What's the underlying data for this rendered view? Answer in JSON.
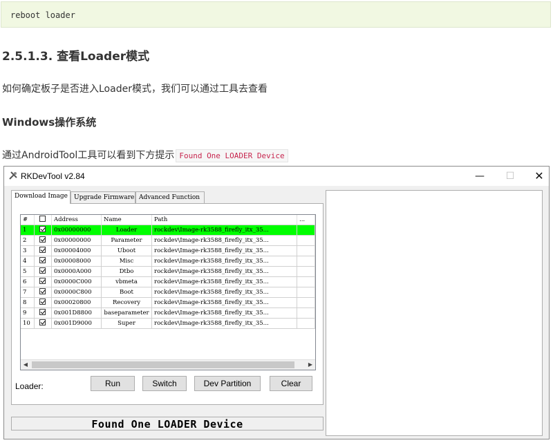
{
  "doc": {
    "code_line": "reboot loader",
    "heading": "2.5.1.3. 查看Loader模式",
    "intro": "如何确定板子是否进入Loader模式，我们可以通过工具去查看",
    "subheading": "Windows操作系统",
    "tool_text": "通过AndroidTool工具可以看到下方提示",
    "inline_code": "Found One LOADER Device"
  },
  "window": {
    "title": "RKDevTool v2.84",
    "minimize": "—",
    "maximize": "☐",
    "close": "✕"
  },
  "tabs": [
    "Download Image",
    "Upgrade Firmware",
    "Advanced Function"
  ],
  "grid": {
    "headers": [
      "#",
      "",
      "Address",
      "Name",
      "Path",
      "..."
    ],
    "rows": [
      {
        "num": "1",
        "checked": true,
        "address": "0x00000000",
        "name": "Loader",
        "path": "rockdev\\Image-rk3588_firefly_itx_35..."
      },
      {
        "num": "2",
        "checked": true,
        "address": "0x00000000",
        "name": "Parameter",
        "path": "rockdev\\Image-rk3588_firefly_itx_35..."
      },
      {
        "num": "3",
        "checked": true,
        "address": "0x00004000",
        "name": "Uboot",
        "path": "rockdev\\Image-rk3588_firefly_itx_35..."
      },
      {
        "num": "4",
        "checked": true,
        "address": "0x00008000",
        "name": "Misc",
        "path": "rockdev\\Image-rk3588_firefly_itx_35..."
      },
      {
        "num": "5",
        "checked": true,
        "address": "0x0000A000",
        "name": "Dtbo",
        "path": "rockdev\\Image-rk3588_firefly_itx_35..."
      },
      {
        "num": "6",
        "checked": true,
        "address": "0x0000C000",
        "name": "vbmeta",
        "path": "rockdev\\Image-rk3588_firefly_itx_35..."
      },
      {
        "num": "7",
        "checked": true,
        "address": "0x0000C800",
        "name": "Boot",
        "path": "rockdev\\Image-rk3588_firefly_itx_35..."
      },
      {
        "num": "8",
        "checked": true,
        "address": "0x00020800",
        "name": "Recovery",
        "path": "rockdev\\Image-rk3588_firefly_itx_35..."
      },
      {
        "num": "9",
        "checked": true,
        "address": "0x001D8800",
        "name": "baseparameter",
        "path": "rockdev\\Image-rk3588_firefly_itx_35..."
      },
      {
        "num": "10",
        "checked": true,
        "address": "0x001D9000",
        "name": "Super",
        "path": "rockdev\\Image-rk3588_firefly_itx_35..."
      }
    ],
    "selected_row": 0
  },
  "loader_label": "Loader:",
  "buttons": {
    "run": "Run",
    "switch": "Switch",
    "dev_partition": "Dev Partition",
    "clear": "Clear"
  },
  "status_text": "Found One LOADER Device",
  "colors": {
    "selected_row": "#00ff00",
    "code_bg": "#f1f8e2",
    "inline_code": "#c7254e"
  }
}
